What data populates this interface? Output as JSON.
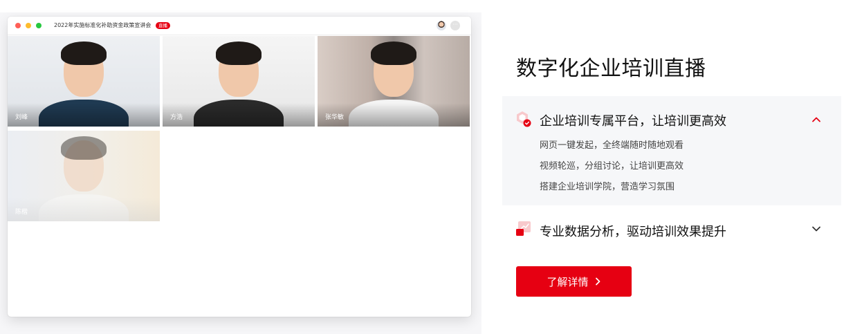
{
  "preview": {
    "window_title": "2022年实施标准化补助资金政策宣讲会",
    "live_badge": "直播",
    "more_icon": "···",
    "participants": [
      {
        "name": "刘峰"
      },
      {
        "name": "方浩"
      },
      {
        "name": "张华敏"
      },
      {
        "name": "陈楷"
      }
    ]
  },
  "panel": {
    "heading": "数字化企业培训直播",
    "features": [
      {
        "title": "企业培训专属平台，让培训更高效",
        "expanded": true,
        "icon": "platform-icon",
        "items": [
          "网页一键发起，全终端随时随地观看",
          "视频轮巡，分组讨论，让培训更高效",
          "搭建企业培训学院，营造学习氛围"
        ]
      },
      {
        "title": "专业数据分析，驱动培训效果提升",
        "expanded": false,
        "icon": "analytics-icon"
      }
    ],
    "cta_label": "了解详情"
  },
  "colors": {
    "accent": "#e60012",
    "accordion_bg": "#f6f7f9",
    "text": "#111111",
    "muted": "#444444"
  }
}
